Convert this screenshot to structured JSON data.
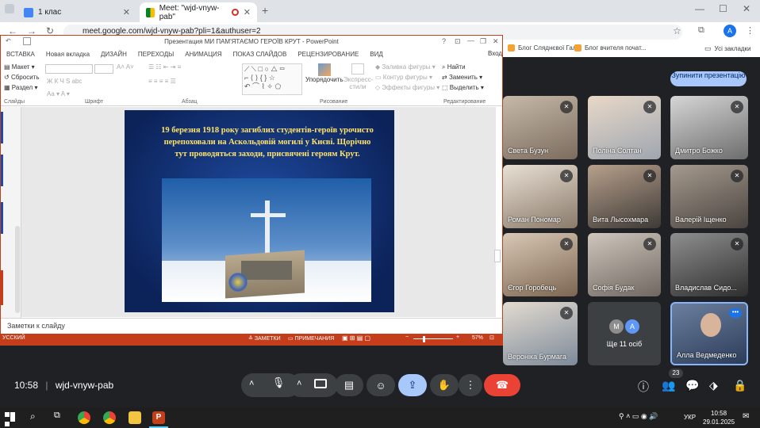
{
  "chrome": {
    "tabs": [
      {
        "title": "1 клас"
      },
      {
        "title": "Meet: \"wjd-vnyw-pab\""
      }
    ],
    "url": "meet.google.com/wjd-vnyw-pab?pli=1&authuser=2",
    "profile_initial": "A",
    "bookmarks": [
      "Блог Сляднєвої Гал...",
      "Блог вчителя почат...",
      "Усі закладки"
    ]
  },
  "ppt": {
    "title": "Презентация МИ ПАМ'ЯТАЄМО ГЕРОЇВ КРУТ - PowerPoint",
    "login": "Вход",
    "tabs": [
      "ВСТАВКА",
      "Новая вкладка",
      "ДИЗАЙН",
      "ПЕРЕХОДЫ",
      "АНИМАЦИЯ",
      "ПОКАЗ СЛАЙДОВ",
      "РЕЦЕНЗИРОВАНИЕ",
      "ВИД"
    ],
    "ribbon": {
      "slides_group": {
        "layout": "Макет",
        "reset": "Сбросить",
        "section": "Раздел",
        "label": "Слайды"
      },
      "font_label": "Шрифт",
      "paragraph_label": "Абзац",
      "drawing": {
        "arrange": "Упорядочить",
        "quick_styles": "Экспресс-стили",
        "fill": "Заливка фигуры",
        "outline": "Контур фигуры",
        "effects": "Эффекты фигуры",
        "label": "Рисование"
      },
      "editing": {
        "find": "Найти",
        "replace": "Заменить",
        "select": "Выделить",
        "label": "Редактирование"
      }
    },
    "slide_text": "19 березня 1918 року загиблих студентів-героїв урочисто перепоховали на Аскольдовій могилі у Києві. Щорічно тут проводяться заходи, присвячені героям Крут.",
    "notes_placeholder": "Заметки к слайду",
    "status": {
      "lang": "УССКИЙ",
      "notes": "ЗАМЕТКИ",
      "comments": "ПРИМЕЧАНИЯ",
      "zoom": "57%"
    }
  },
  "meet": {
    "stop_presenting": "Зупинити презентацію",
    "participants": [
      {
        "name": "Света Бузун"
      },
      {
        "name": "Поліна Солтан"
      },
      {
        "name": "Дмитро Божко"
      },
      {
        "name": "Роман Пономар"
      },
      {
        "name": "Вита Лысохмара"
      },
      {
        "name": "Валерій Іщенко"
      },
      {
        "name": "Єгор Горобець"
      },
      {
        "name": "Софія Будак"
      },
      {
        "name": "Владислав Сидо..."
      },
      {
        "name": "Вероніка Бурмага"
      },
      {
        "name": "Ще 11 осіб"
      },
      {
        "name": "Алла Ведмеденко"
      }
    ],
    "more_avatars": [
      "M",
      "A"
    ],
    "time": "10:58",
    "meeting_code": "wjd-vnyw-pab",
    "participant_count": "23"
  },
  "taskbar": {
    "lang": "УКР",
    "time": "10:58",
    "date": "29.01.2025"
  },
  "colors": {
    "ppt_accent": "#c43e1c",
    "meet_bg": "#202124",
    "slide_bg": "#0f2a66",
    "slide_text": "#ffe36b",
    "end_call": "#ea4335",
    "active_blue": "#a8c7fa"
  }
}
